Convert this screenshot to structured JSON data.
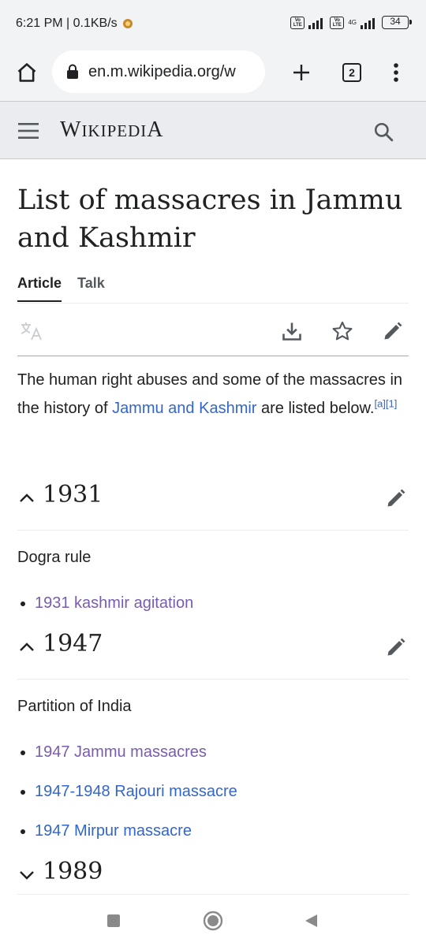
{
  "status": {
    "time_speed": "6:21 PM | 0.1KB/s",
    "volte1": "Vo LTE",
    "volte2": "Vo LTE",
    "net": "4G",
    "battery": "34"
  },
  "browser": {
    "url": "en.m.wikipedia.org/w",
    "tab_count": "2"
  },
  "wiki": {
    "wordmark_w": "W",
    "wordmark_rest": "IKIPEDI",
    "wordmark_a": "A"
  },
  "article": {
    "title": "List of massacres in Jammu and Kashmir",
    "tabs": [
      {
        "label": "Article"
      },
      {
        "label": "Talk"
      }
    ],
    "intro_before": "The human right abuses and some of the massacres in the history of ",
    "intro_link": "Jammu and Kashmir",
    "intro_after": " are listed below.",
    "ref_a": "[a]",
    "ref_1": "[1]"
  },
  "sections": [
    {
      "year": "1931",
      "subtitle": "Dogra rule",
      "items": [
        "1931 kashmir agitation"
      ]
    },
    {
      "year": "1947",
      "subtitle": "Partition of India",
      "items": [
        "1947 Jammu massacres",
        "1947-1948 Rajouri massacre",
        "1947 Mirpur massacre"
      ]
    },
    {
      "year": "1989"
    }
  ],
  "colors": {
    "link": "#3366cc",
    "visited_link": "#795cb2",
    "header_bg": "#eaecf0"
  }
}
